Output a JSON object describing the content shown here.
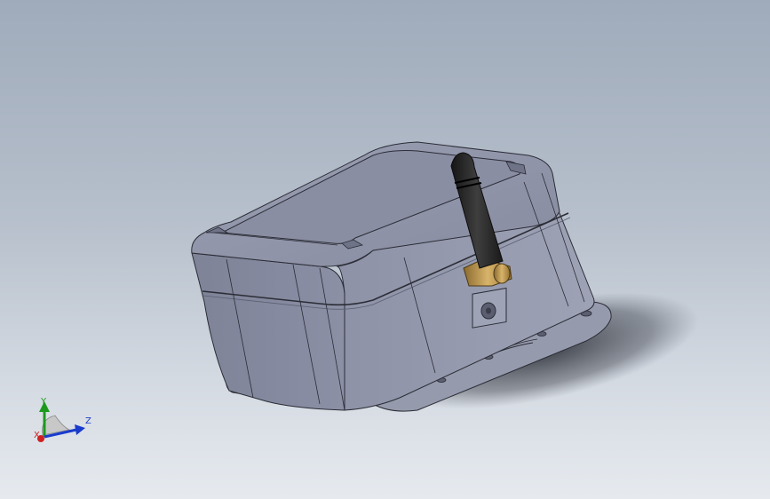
{
  "triad": {
    "x_label": "X",
    "y_label": "Y",
    "z_label": "Z"
  },
  "colors": {
    "background_top": "#9fabbb",
    "background_bottom": "#e6eaef",
    "enclosure_body": "#878a9e",
    "enclosure_lid": "#8e92a6",
    "antenna": "#2a2a2a",
    "connector": "#b8914a",
    "axis_x": "#d02020",
    "axis_y": "#1d9a1d",
    "axis_z": "#1a3ccc"
  }
}
